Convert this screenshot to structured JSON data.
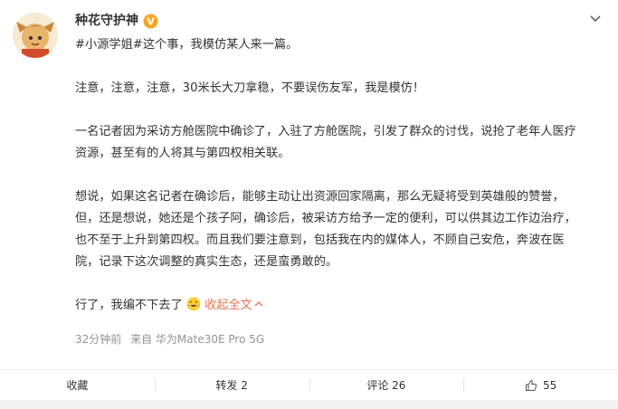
{
  "post": {
    "username": "种花守护神",
    "hashtag": "#小源学姐#",
    "line1_rest": "这个事，我模仿某人来一篇。",
    "para2": "注意，注意，注意，30米长大刀拿稳，不要误伤友军，我是模仿！",
    "para3_line1": "一名记者因为采访方舱医院中确诊了，入驻了方舱医院，引发了群众的讨伐，说抢了老年人医疗",
    "para3_line2": "资源，甚至有的人将其与第四权相关联。",
    "para4_line1": "想说，如果这名记者在确诊后，能够主动让出资源回家隔离，那么无疑将受到英雄般的赞誉，",
    "para4_line2": "但，还是想说，她还是个孩子阿，确诊后，被采访方给予一定的便利，可以供其边工作边治疗，",
    "para4_line3": "也不至于上升到第四权。而且我们要注意到，包括我在内的媒体人，不顾自己安危，奔波在医",
    "para4_line4": "院，记录下这次调整的真实生态，还是蛮勇敢的。",
    "para5": "行了，我编不下去了",
    "collapse_label": "收起全文",
    "time": "32分钟前",
    "source": "来自 华为Mate30E Pro 5G"
  },
  "toolbar": {
    "favorite": "收藏",
    "repost": "转发 2",
    "comment": "评论 26",
    "like_count": "55"
  },
  "icons": {
    "verified": "verified-badge-icon",
    "more": "chevron-down-icon",
    "emoji": "crying-laughing-emoji-icon",
    "like": "thumbs-up-icon",
    "collapse": "chevron-up-icon"
  },
  "colors": {
    "link": "#eb7350",
    "verified": "#f5a623",
    "meta": "#939393"
  }
}
